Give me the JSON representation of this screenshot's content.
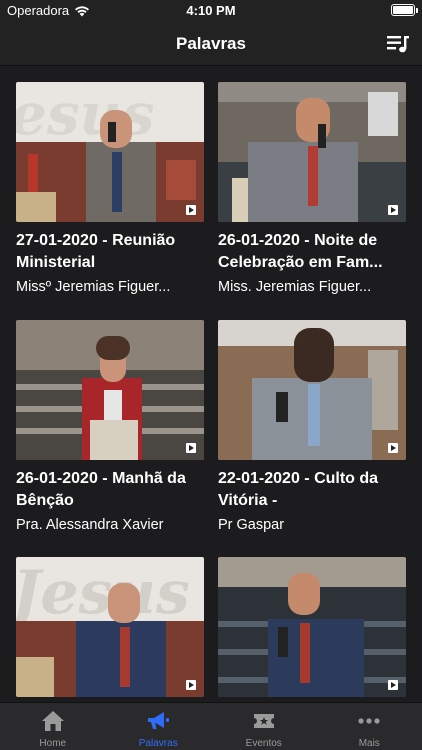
{
  "status_bar": {
    "carrier": "Operadora",
    "time": "4:10 PM"
  },
  "nav": {
    "title": "Palavras"
  },
  "videos": [
    {
      "title": "27-01-2020 - Reunião Ministerial",
      "author": "Missº Jeremias Figuer..."
    },
    {
      "title": "26-01-2020 - Noite de Celebração em Fam...",
      "author": "Miss. Jeremias Figuer..."
    },
    {
      "title": "26-01-2020 - Manhã da Bênção",
      "author": "Pra. Alessandra Xavier"
    },
    {
      "title": "22-01-2020 - Culto da Vitória -",
      "author": "Pr Gaspar"
    },
    {
      "title": "",
      "author": ""
    },
    {
      "title": "",
      "author": ""
    }
  ],
  "tabs": [
    {
      "label": "Home",
      "icon": "home-icon",
      "active": false
    },
    {
      "label": "Palavras",
      "icon": "megaphone-icon",
      "active": true
    },
    {
      "label": "Eventos",
      "icon": "ticket-icon",
      "active": false
    },
    {
      "label": "Mais",
      "icon": "more-icon",
      "active": false
    }
  ],
  "colors": {
    "accent": "#2f6df6",
    "background": "#1c1c1e",
    "bar": "#222222",
    "tab_inactive": "#9a9a9a"
  }
}
